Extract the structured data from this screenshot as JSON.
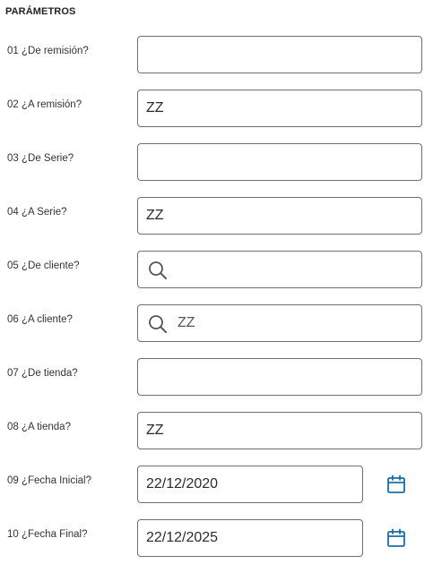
{
  "section": {
    "title": "PARÁMETROS"
  },
  "params": [
    {
      "label": "01 ¿De remisión?",
      "value": ""
    },
    {
      "label": "02 ¿A remisión?",
      "value": "ZZ"
    },
    {
      "label": "03 ¿De Serie?",
      "value": ""
    },
    {
      "label": "04 ¿A Serie?",
      "value": "ZZ"
    },
    {
      "label": "05 ¿De cliente?",
      "value": "",
      "icon": "search-icon"
    },
    {
      "label": "06 ¿A cliente?",
      "value": "ZZ",
      "icon": "search-icon"
    },
    {
      "label": "07 ¿De tienda?",
      "value": ""
    },
    {
      "label": "08 ¿A tienda?",
      "value": "ZZ"
    },
    {
      "label": "09 ¿Fecha Inicial?",
      "value": "22/12/2020",
      "icon": "calendar-icon"
    },
    {
      "label": "10 ¿Fecha Final?",
      "value": "22/12/2025",
      "icon": "calendar-icon"
    }
  ],
  "colors": {
    "field_border": "#6f6f6f",
    "calendar_icon": "#1a6ea8",
    "search_icon": "#555555"
  }
}
